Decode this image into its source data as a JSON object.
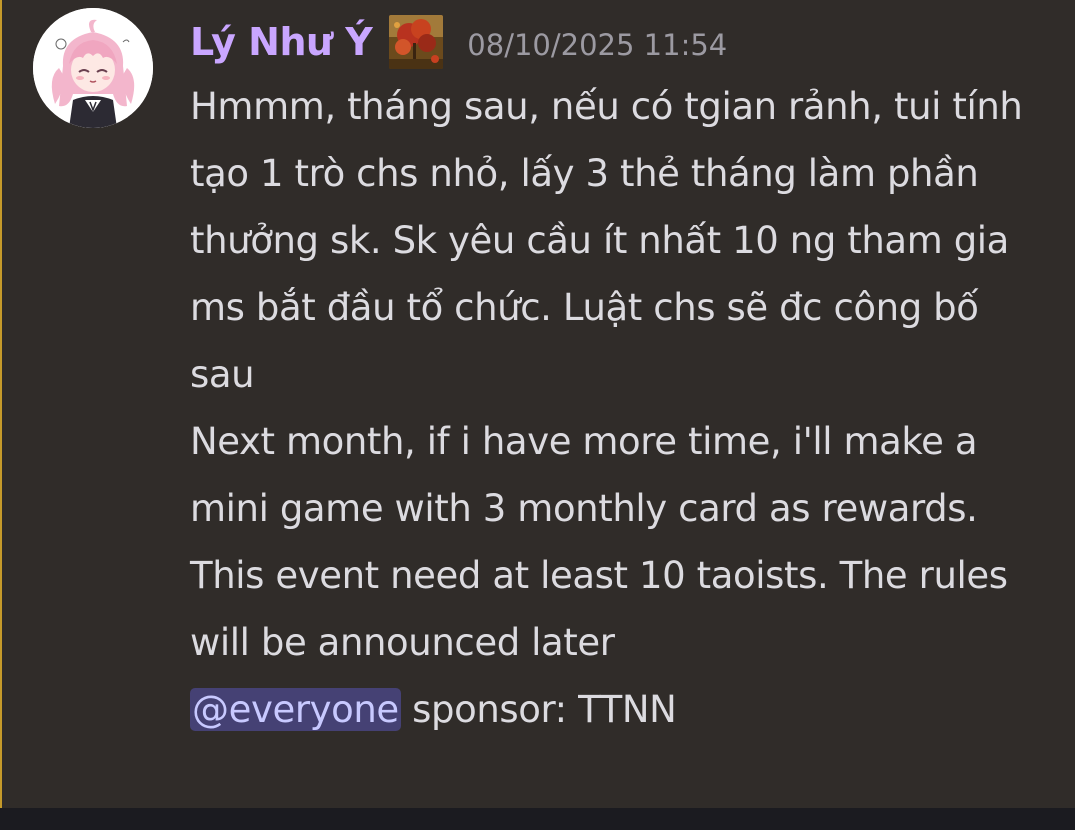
{
  "message": {
    "author": "Lý Như Ý",
    "timestamp": "08/10/2025 11:54",
    "paragraphs": [
      "Hmmm, tháng sau, nếu có tgian rảnh, tui tính tạo 1 trò chs nhỏ, lấy 3 thẻ tháng làm phần thưởng sk. Sk yêu cầu ít nhất 10 ng tham gia ms bắt đầu tổ chức. Luật chs sẽ đc công bố sau",
      "Next month, if i have more time, i'll make a mini game with 3 monthly card as rewards. This event need at least 10 taoists. The rules will be announced later"
    ],
    "mention": "@everyone",
    "mention_suffix": " sponsor: TTNN"
  },
  "icons": {
    "avatar": "anime-girl-avatar",
    "role_icon": "red-maple-landscape-role-icon"
  },
  "colors": {
    "background": "#302c29",
    "username": "#c9a6ff",
    "timestamp": "#9c9aa2",
    "text": "#dcdbe0",
    "mention_bg": "#454174",
    "mention_text": "#c8c9ff",
    "left_accent": "#c59a2a"
  }
}
